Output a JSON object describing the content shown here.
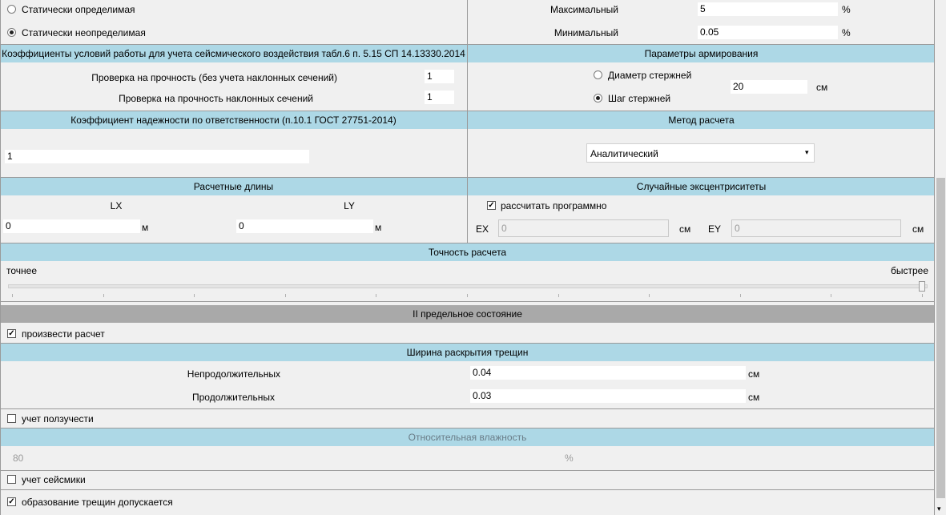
{
  "top": {
    "radio_determinate": "Статически определимая",
    "radio_indeterminate": "Статически неопределимая",
    "max_label": "Максимальный",
    "max_value": "5",
    "min_label": "Минимальный",
    "min_value": "0.05",
    "percent": "%"
  },
  "seismic_coef": {
    "header": "Коэффициенты условий работы для учета сейсмического воздействия табл.6 п. 5.15 СП 14.13330.2014",
    "strength_label": "Проверка на прочность (без учета наклонных сечений)",
    "strength_value": "1",
    "inclined_label": "Проверка на прочность наклонных сечений",
    "inclined_value": "1"
  },
  "reinforcement": {
    "header": "Параметры армирования",
    "diameter_label": "Диаметр стержней",
    "step_label": "Шаг стержней",
    "value": "20",
    "unit": "см"
  },
  "reliability": {
    "header": "Коэффициент надежности по ответственности (п.10.1 ГОСТ 27751-2014)",
    "value": "1"
  },
  "method": {
    "header": "Метод расчета",
    "selected": "Аналитический"
  },
  "lengths": {
    "header": "Расчетные длины",
    "lx_label": "LX",
    "ly_label": "LY",
    "lx_value": "0",
    "ly_value": "0",
    "unit": "м"
  },
  "eccentricity": {
    "header": "Случайные эксцентриситеты",
    "auto_label": "рассчитать программно",
    "ex_label": "EX",
    "ex_value": "0",
    "ey_label": "EY",
    "ey_value": "0",
    "unit": "см"
  },
  "precision": {
    "header": "Точность расчета",
    "left_label": "точнее",
    "right_label": "быстрее",
    "slider_level": 1.0
  },
  "limit2": {
    "header": "II предельное состояние",
    "do_calc_label": "произвести расчет"
  },
  "cracks": {
    "header": "Ширина раскрытия трещин",
    "short_label": "Непродолжительных",
    "short_value": "0.04",
    "long_label": "Продолжительных",
    "long_value": "0.03",
    "unit": "см"
  },
  "creep": {
    "label": "учет ползучести"
  },
  "humidity": {
    "header": "Относительная влажность",
    "value": "80",
    "unit": "%"
  },
  "seismic": {
    "label": "учет сейсмики"
  },
  "crack_allowed": {
    "label": "образование трещин допускается"
  }
}
